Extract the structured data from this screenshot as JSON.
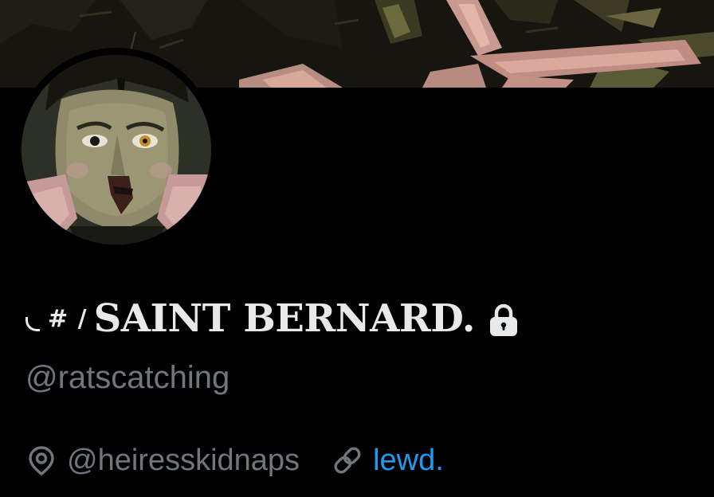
{
  "profile": {
    "display_name_prefix": "#",
    "display_name_slash": "/",
    "display_name": "SAINT BERNARD.",
    "handle": "@ratscatching",
    "location": "@heiresskidnaps",
    "website": "lewd.",
    "protected": true
  },
  "icons": {
    "lock": "lock-icon",
    "location": "location-pin-icon",
    "link": "link-icon"
  },
  "colors": {
    "background": "#000000",
    "text_primary": "#e7e9ea",
    "text_secondary": "#71767b",
    "link": "#1d9bf0"
  }
}
